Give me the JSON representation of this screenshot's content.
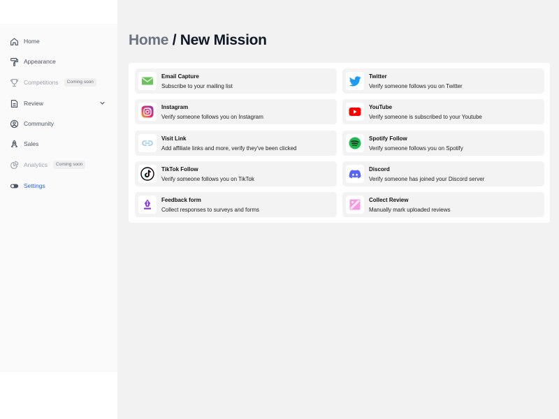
{
  "sidebar": {
    "items": [
      {
        "label": "Home",
        "icon": "home-icon"
      },
      {
        "label": "Appearance",
        "icon": "paint-roller-icon"
      },
      {
        "label": "Competitions",
        "icon": "trophy-icon",
        "badge": "Coming soon"
      },
      {
        "label": "Review",
        "icon": "document-icon"
      },
      {
        "label": "Community",
        "icon": "user-circle-icon"
      },
      {
        "label": "Sales",
        "icon": "rocket-icon"
      },
      {
        "label": "Analytics",
        "icon": "pie-chart-icon",
        "badge": "Coming soon"
      },
      {
        "label": "Settings",
        "icon": "toggle-icon"
      }
    ],
    "active_color": "#2563eb"
  },
  "breadcrumb": {
    "home": "Home",
    "separator": " / ",
    "current": "New Mission"
  },
  "missions": [
    {
      "title": "Email Capture",
      "description": "Subscribe to your mailing list",
      "icon": "envelope-icon",
      "color": "#6cc35b"
    },
    {
      "title": "Twitter",
      "description": "Verify someone follows you on Twitter",
      "icon": "twitter-bird-icon",
      "color": "#1d9bf0"
    },
    {
      "title": "Instagram",
      "description": "Verify someone follows you on Instagram",
      "icon": "instagram-icon",
      "color": "#e1306c"
    },
    {
      "title": "YouTube",
      "description": "Verify someone is subscribed to your Youtube",
      "icon": "youtube-icon",
      "color": "#ff0000"
    },
    {
      "title": "Visit Link",
      "description": "Add affiliate links and more, verify they've been clicked",
      "icon": "link-icon",
      "color": "#9cc9ea"
    },
    {
      "title": "Spotify Follow",
      "description": "Verify someone follows you on Spotify",
      "icon": "spotify-icon",
      "color": "#1db954"
    },
    {
      "title": "TikTok Follow",
      "description": "Verify someone follows you on TikTok",
      "icon": "tiktok-icon",
      "color": "#000000"
    },
    {
      "title": "Discord",
      "description": "Verify someone has joined your Discord server",
      "icon": "discord-icon",
      "color": "#5865f2"
    },
    {
      "title": "Feedback form",
      "description": "Collect responses to surveys and forms",
      "icon": "fountain-pen-icon",
      "color": "#8b3fd9"
    },
    {
      "title": "Collect Review",
      "description": "Manually mark uploaded reviews",
      "icon": "image-review-icon",
      "color": "#f29be0"
    }
  ]
}
